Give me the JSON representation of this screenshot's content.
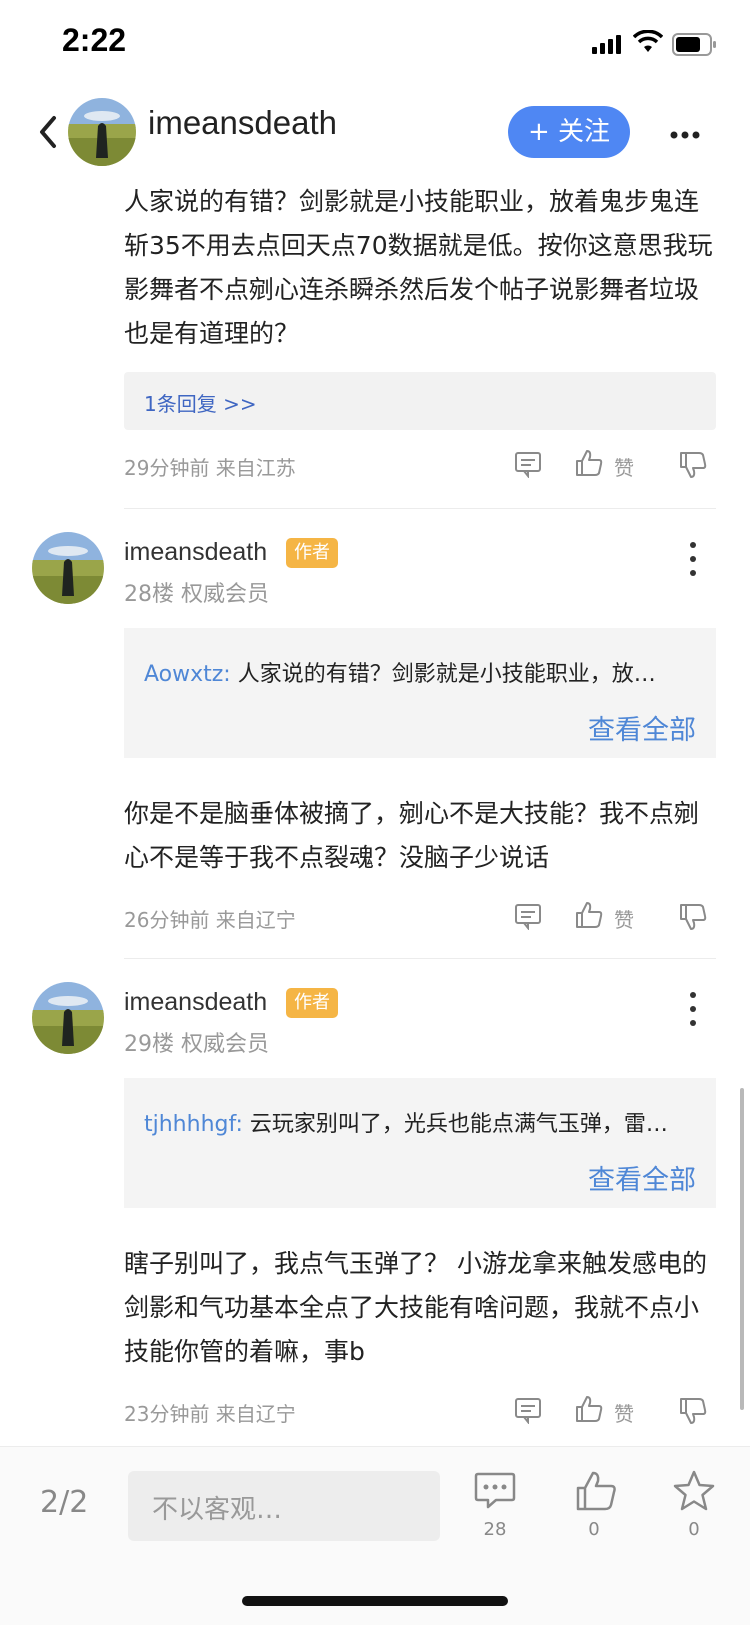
{
  "status_bar": {
    "time": "2:22"
  },
  "header": {
    "username": "imeansdeath",
    "follow_label": "+ 关注"
  },
  "comments": [
    {
      "content": "人家说的有错？剑影就是小技能职业，放着鬼步鬼连斩35不用去点回天点70数据就是低。按你这意思我玩影舞者不点剜心连杀瞬杀然后发个帖子说影舞者垃圾也是有道理的？",
      "replies_link": "1条回复 >>",
      "time_location": "29分钟前 来自江苏",
      "like_label": "赞"
    },
    {
      "user": "imeansdeath",
      "badge": "作者",
      "floor_info": "28楼 权威会员",
      "quote_user": "Aowxtz:",
      "quote_text": "人家说的有错？剑影就是小技能职业，放…",
      "view_all": "查看全部",
      "content": "你是不是脑垂体被摘了，剜心不是大技能？我不点剜心不是等于我不点裂魂？没脑子少说话",
      "time_location": "26分钟前 来自辽宁",
      "like_label": "赞"
    },
    {
      "user": "imeansdeath",
      "badge": "作者",
      "floor_info": "29楼 权威会员",
      "quote_user": "tjhhhhgf:",
      "quote_text": "云玩家别叫了，光兵也能点满气玉弹，雷…",
      "view_all": "查看全部",
      "content": "瞎子别叫了，我点气玉弹了？ 小游龙拿来触发感电的 剑影和气功基本全点了大技能有啥问题，我就不点小技能你管的着嘛，事b",
      "time_location": "23分钟前 来自辽宁",
      "like_label": "赞"
    }
  ],
  "bottom_bar": {
    "page_indicator": "2/2",
    "input_placeholder": "不以客观…",
    "comment_count": "28",
    "like_count": "0",
    "favorite_count": "0"
  },
  "colors": {
    "accent": "#4f87f3",
    "badge": "#f5b545",
    "link": "#3f66c2"
  }
}
